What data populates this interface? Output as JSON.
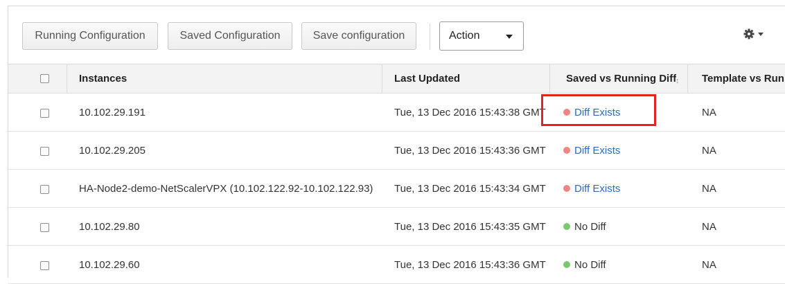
{
  "toolbar": {
    "buttons": [
      "Running Configuration",
      "Saved Configuration",
      "Save configuration"
    ],
    "action_select": "Action",
    "settings_icon": "gear-icon"
  },
  "table": {
    "columns": [
      "Instances",
      "Last Updated",
      "Saved vs Running Diff",
      "Template vs Run"
    ],
    "rows": [
      {
        "instance": "10.102.29.191",
        "last_updated": "Tue, 13 Dec 2016 15:43:38 GMT",
        "diff": "Diff Exists",
        "diff_status": "diff",
        "template": "NA"
      },
      {
        "instance": "10.102.29.205",
        "last_updated": "Tue, 13 Dec 2016 15:43:36 GMT",
        "diff": "Diff Exists",
        "diff_status": "diff",
        "template": "NA"
      },
      {
        "instance": "HA-Node2-demo-NetScalerVPX (10.102.122.92-10.102.122.93)",
        "last_updated": "Tue, 13 Dec 2016 15:43:34 GMT",
        "diff": "Diff Exists",
        "diff_status": "diff",
        "template": "NA"
      },
      {
        "instance": "10.102.29.80",
        "last_updated": "Tue, 13 Dec 2016 15:43:35 GMT",
        "diff": "No Diff",
        "diff_status": "nodiff",
        "template": "NA"
      },
      {
        "instance": "10.102.29.60",
        "last_updated": "Tue, 13 Dec 2016 15:43:36 GMT",
        "diff": "No Diff",
        "diff_status": "nodiff",
        "template": "NA"
      }
    ]
  },
  "colors": {
    "diff_dot": "#ef8585",
    "nodiff_dot": "#7bc96f",
    "link": "#2a6bbf",
    "highlight": "#e32222"
  }
}
